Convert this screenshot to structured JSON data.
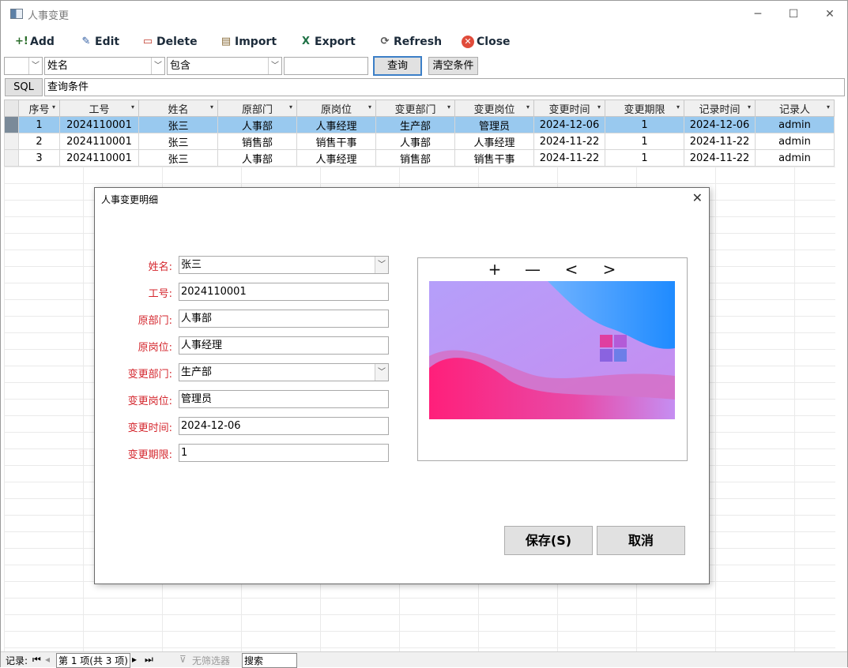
{
  "window": {
    "title": "人事变更",
    "controls": [
      "minimize-icon",
      "maximize-icon",
      "close-icon"
    ]
  },
  "toolbar": {
    "add": "Add",
    "edit": "Edit",
    "delete": "Delete",
    "import": "Import",
    "export": "Export",
    "refresh": "Refresh",
    "close": "Close"
  },
  "filter": {
    "field": "姓名",
    "op": "包含",
    "value": "",
    "query": "查询",
    "clear": "清空条件"
  },
  "sql": {
    "label": "SQL",
    "text": "查询条件"
  },
  "table": {
    "columns": [
      "序号",
      "工号",
      "姓名",
      "原部门",
      "原岗位",
      "变更部门",
      "变更岗位",
      "变更时间",
      "变更期限",
      "记录时间",
      "记录人"
    ],
    "rows": [
      [
        "1",
        "2024110001",
        "张三",
        "人事部",
        "人事经理",
        "生产部",
        "管理员",
        "2024-12-06",
        "1",
        "2024-12-06",
        "admin"
      ],
      [
        "2",
        "2024110001",
        "张三",
        "销售部",
        "销售干事",
        "人事部",
        "人事经理",
        "2024-11-22",
        "1",
        "2024-11-22",
        "admin"
      ],
      [
        "3",
        "2024110001",
        "张三",
        "人事部",
        "人事经理",
        "销售部",
        "销售干事",
        "2024-11-22",
        "1",
        "2024-11-22",
        "admin"
      ]
    ],
    "selected_row": 0
  },
  "dialog": {
    "title": "人事变更明细",
    "fields": [
      {
        "label": "姓名:",
        "value": "张三",
        "dropdown": true
      },
      {
        "label": "工号:",
        "value": "2024110001",
        "dropdown": false
      },
      {
        "label": "原部门:",
        "value": "人事部",
        "dropdown": false
      },
      {
        "label": "原岗位:",
        "value": "人事经理",
        "dropdown": false
      },
      {
        "label": "变更部门:",
        "value": "生产部",
        "dropdown": true
      },
      {
        "label": "变更岗位:",
        "value": "管理员",
        "dropdown": false
      },
      {
        "label": "变更时间:",
        "value": "2024-12-06",
        "dropdown": false
      },
      {
        "label": "变更期限:",
        "value": "1",
        "dropdown": false
      }
    ],
    "image_controls": [
      "+",
      "—",
      "<",
      ">"
    ],
    "save": "保存(S)",
    "cancel": "取消"
  },
  "statusbar": {
    "records": "记录:",
    "page": "第 1 项(共 3 项)",
    "filter": "无筛选器",
    "search": "搜索"
  }
}
